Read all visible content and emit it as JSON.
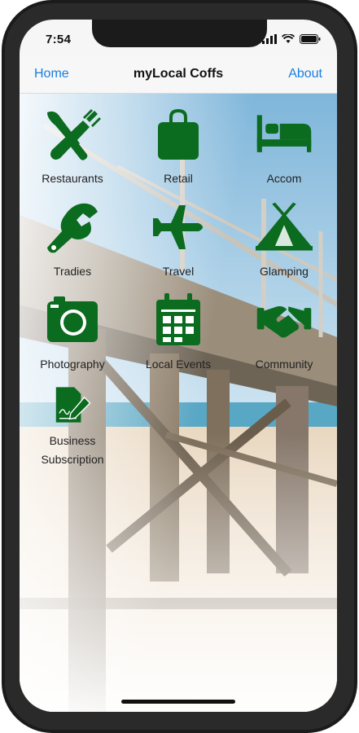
{
  "status": {
    "time": "7:54"
  },
  "nav": {
    "left": "Home",
    "title": "myLocal Coffs",
    "right": "About"
  },
  "accent_color": "#0b6b1f",
  "categories": [
    {
      "label": "Restaurants",
      "icon": "fork-knife-icon"
    },
    {
      "label": "Retail",
      "icon": "shopping-bag-icon"
    },
    {
      "label": "Accom",
      "icon": "bed-icon"
    },
    {
      "label": "Tradies",
      "icon": "wrench-icon"
    },
    {
      "label": "Travel",
      "icon": "airplane-icon"
    },
    {
      "label": "Glamping",
      "icon": "tent-icon"
    },
    {
      "label": "Photography",
      "icon": "camera-icon"
    },
    {
      "label": "Local Events",
      "icon": "calendar-icon"
    },
    {
      "label": "Community",
      "icon": "handshake-icon"
    },
    {
      "label": "Business Subscription",
      "icon": "contract-sign-icon"
    }
  ]
}
